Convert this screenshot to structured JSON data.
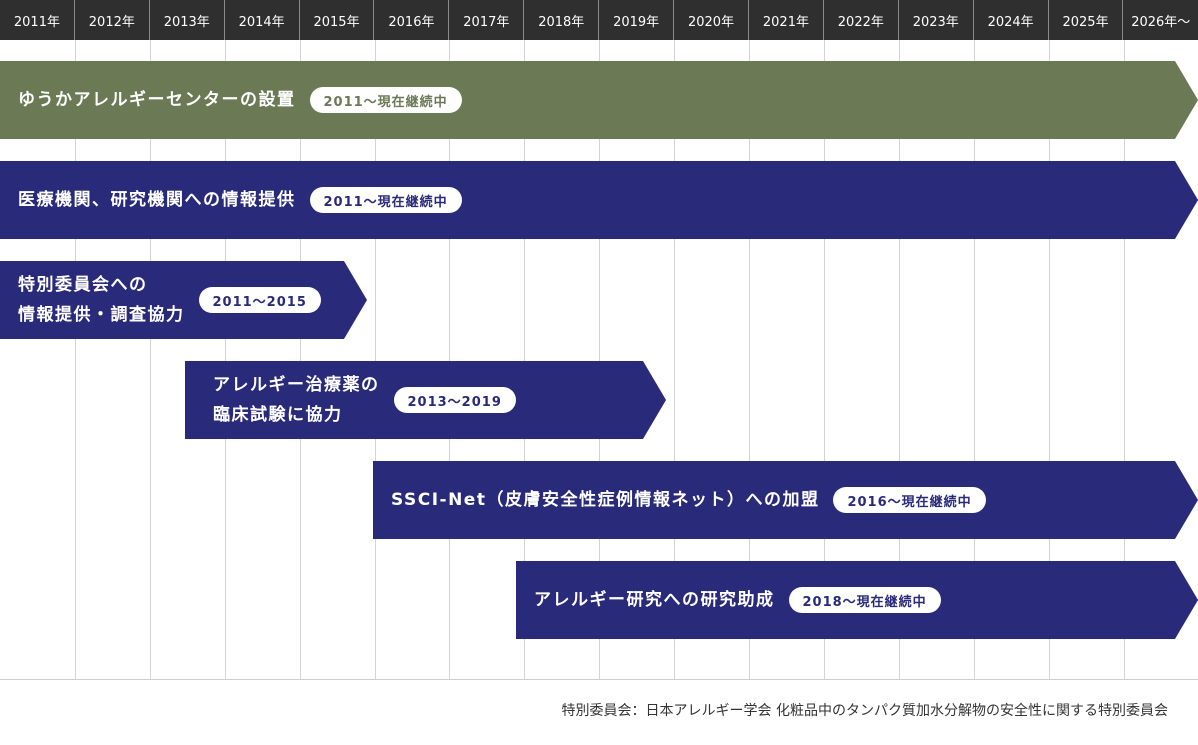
{
  "years": [
    "2011年",
    "2012年",
    "2013年",
    "2014年",
    "2015年",
    "2016年",
    "2017年",
    "2018年",
    "2019年",
    "2020年",
    "2021年",
    "2022年",
    "2023年",
    "2024年",
    "2025年",
    "2026年〜"
  ],
  "colors": {
    "olive": "#6b7955",
    "navy": "#2a2a7a",
    "header": "#2f2f2f"
  },
  "bars": [
    {
      "lines": [
        "ゆうかアレルギーセンターの設置"
      ],
      "period": "2011〜現在継続中",
      "start_year": "2011",
      "end_year": "現在継続中",
      "color": "#6b7955"
    },
    {
      "lines": [
        "医療機関、研究機関への情報提供"
      ],
      "period": "2011〜現在継続中",
      "start_year": "2011",
      "end_year": "現在継続中",
      "color": "#2a2a7a"
    },
    {
      "lines": [
        "特別委員会への",
        "情報提供・調査協力"
      ],
      "period": "2011〜2015",
      "start_year": "2011",
      "end_year": "2015",
      "color": "#2a2a7a"
    },
    {
      "lines": [
        "アレルギー治療薬の",
        "臨床試験に協力"
      ],
      "period": "2013〜2019",
      "start_year": "2013",
      "end_year": "2019",
      "color": "#2a2a7a"
    },
    {
      "lines": [
        "SSCI-Net（皮膚安全性症例情報ネット）への加盟"
      ],
      "period": "2016〜現在継続中",
      "start_year": "2016",
      "end_year": "現在継続中",
      "color": "#2a2a7a"
    },
    {
      "lines": [
        "アレルギー研究への研究助成"
      ],
      "period": "2018〜現在継続中",
      "start_year": "2018",
      "end_year": "現在継続中",
      "color": "#2a2a7a"
    }
  ],
  "footnote": "特別委員会：日本アレルギー学会 化粧品中のタンパク質加水分解物の安全性に関する特別委員会"
}
